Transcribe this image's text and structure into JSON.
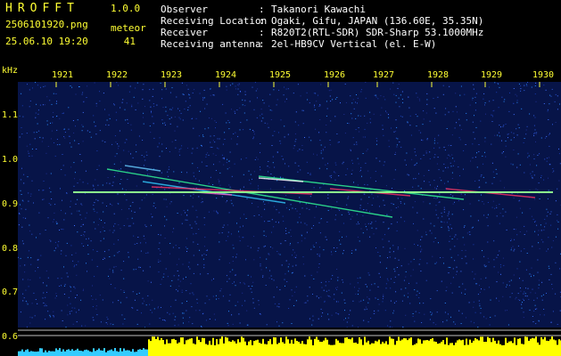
{
  "header": {
    "app_title": "HROFFT",
    "app_version": "1.0.0",
    "file_name": "2506101920.png",
    "date_time": "25.06.10 19:20",
    "meteor_label": "meteor",
    "meteor_count": "41"
  },
  "info": [
    {
      "key": "Observer",
      "sep": ":",
      "value": "Takanori Kawachi"
    },
    {
      "key": "Receiving Location",
      "sep": ":",
      "value": "Ogaki, Gifu, JAPAN (136.60E, 35.35N)"
    },
    {
      "key": "Receiver",
      "sep": ":",
      "value": "R820T2(RTL-SDR) SDR-Sharp 53.1000MHz"
    },
    {
      "key": "Receiving antenna",
      "sep": ":",
      "value": "2el-HB9CV Vertical (el. E-W)"
    }
  ],
  "axes": {
    "y_unit": "kHz",
    "x_ticks": [
      "1921",
      "1922",
      "1923",
      "1924",
      "1925",
      "1926",
      "1927",
      "1928",
      "1929",
      "1930"
    ],
    "y_ticks": [
      "1.1",
      "1.0",
      "0.9",
      "0.8",
      "0.7",
      "0.6"
    ]
  },
  "colors": {
    "text_yellow": "#ffff33",
    "background_noise": "#0a1a60",
    "carrier": "#66ff99",
    "meteor_hot": "#ff3366",
    "level_fill": "#ffff00",
    "level_low": "#33ccff"
  }
}
